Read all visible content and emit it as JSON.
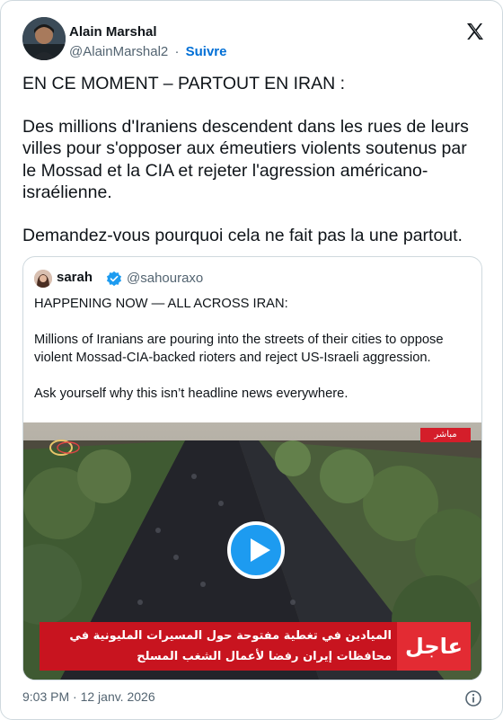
{
  "author": {
    "name": "Alain Marshal",
    "handle": "@AlainMarshal2",
    "separator": "·",
    "follow_label": "Suivre"
  },
  "tweet": {
    "line1": "EN CE MOMENT – PARTOUT EN IRAN :",
    "para2": "Des millions d'Iraniens descendent dans les rues de leurs villes pour s'opposer aux émeutiers violents soutenus par le Mossad et la CIA et rejeter l'agression américano-israélienne.",
    "para3": "Demandez-vous pourquoi cela ne fait pas la une partout."
  },
  "quoted": {
    "name": "sarah",
    "handle": "@sahouraxo",
    "line1": "HAPPENING NOW — ALL ACROSS IRAN:",
    "para2": "Millions of Iranians are pouring into the streets of their cities to oppose violent Mossad-CIA-backed rioters and reject US-Israeli aggression.",
    "para3": "Ask yourself why this isn’t headline news everywhere.",
    "media": {
      "live_tag": "مباشر",
      "banner_urgent": "عاجل",
      "banner_line1": "الميادين في تغطية مفتوحة حول المسيرات المليونية في",
      "banner_line2": "محافظات إيران رفضا لأعمال الشغب المسلح"
    }
  },
  "footer": {
    "timestamp": "9:03 PM · 12 janv. 2026"
  },
  "colors": {
    "accent": "#1d9bf0",
    "follow": "#006fd6",
    "verified": "#1d9bf0",
    "banner_red": "#c8141f",
    "text": "#0f1419",
    "muted": "#536471",
    "border": "#cfd9de"
  },
  "icons": {
    "logo": "x-logo-icon",
    "verified": "verified-badge-icon",
    "play": "play-icon",
    "info": "info-icon"
  }
}
